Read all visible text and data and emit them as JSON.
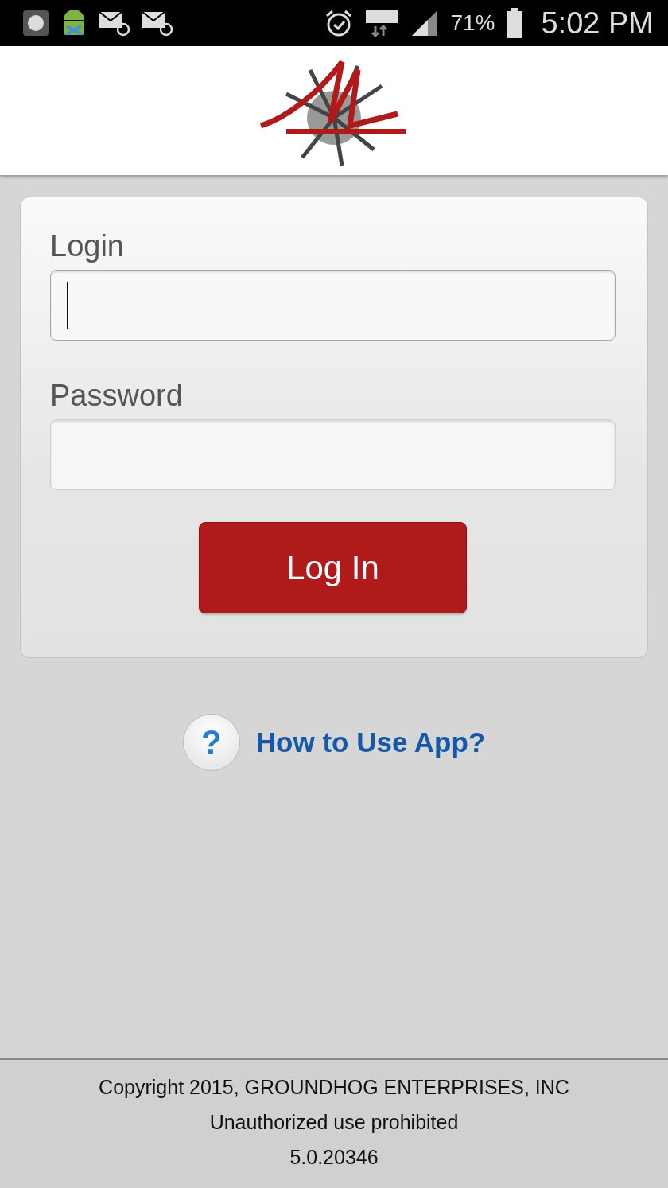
{
  "status_bar": {
    "battery": "71%",
    "time": "5:02 PM"
  },
  "login_form": {
    "fields": [
      {
        "label": "Login",
        "focused": true
      },
      {
        "label": "Password",
        "focused": false
      }
    ],
    "submit": "Log In"
  },
  "help_link": {
    "icon": "?",
    "label": "How to Use App?"
  },
  "footer": [
    "Copyright 2015, GROUNDHOG ENTERPRISES, INC",
    "Unauthorized use prohibited",
    "5.0.20346"
  ]
}
